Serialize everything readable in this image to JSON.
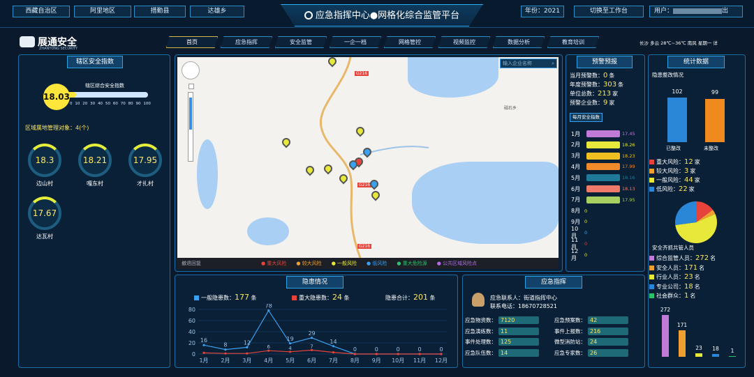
{
  "top_left_buttons": [
    "西藏自治区",
    "阿里地区",
    "措勤县",
    "达雄乡"
  ],
  "title": "应急指挥中心●网格化综合监管平台",
  "year_label": "年份：2021",
  "switch_label": "切换至工作台",
  "user_label": "用户：",
  "logout_label": "出",
  "logo": {
    "main": "展通安全",
    "sub": "ZHANTONG SECURITY"
  },
  "nav": [
    "首页",
    "应急指挥",
    "安全监管",
    "一企一档",
    "网格管控",
    "视频监控",
    "数据分析",
    "教育培训"
  ],
  "weather": "长沙  多云 28℃~36℃  南风  星期一  详",
  "left": {
    "title": "辖区安全指数",
    "index_value": "18.03",
    "index_label": "辖区综合安全指数",
    "scale": [
      "0",
      "10",
      "20",
      "30",
      "40",
      "50",
      "60",
      "70",
      "80",
      "90",
      "100"
    ],
    "area_label": "区域属地管理对象：4(个)",
    "villages": [
      {
        "name": "边山村",
        "value": "18.3"
      },
      {
        "name": "嘎东村",
        "value": "18.21"
      },
      {
        "name": "才扎村",
        "value": "17.95"
      },
      {
        "name": "达瓦村",
        "value": "17.67"
      }
    ]
  },
  "map": {
    "search_placeholder": "输入企业名称",
    "road": "G216",
    "place": "磁石乡",
    "legend": [
      "重大风险",
      "较大风险",
      "一般风险",
      "低风险",
      "重大危险源",
      "公共区域风险点"
    ],
    "legend_colors": [
      "#e8433b",
      "#f0a030",
      "#e8e83a",
      "#3aa0f0",
      "#2ac26a",
      "#b56ae8"
    ],
    "bottom_label": "撤退回复"
  },
  "warn": {
    "title": "预警预报",
    "stats": [
      {
        "label": "当月预警数：",
        "value": "0",
        "unit": "条"
      },
      {
        "label": "年度预警数：",
        "value": "303",
        "unit": "条"
      },
      {
        "label": "单位总数：",
        "value": "213",
        "unit": "家"
      },
      {
        "label": "预警企业数：",
        "value": "9",
        "unit": "家"
      }
    ],
    "button": "每月安全指数",
    "months": [
      {
        "m": "1月",
        "v": "17.45",
        "color": "#c07ad8",
        "frac": 0.8
      },
      {
        "m": "2月",
        "v": "18.26",
        "color": "#e8e83a",
        "frac": 0.8
      },
      {
        "m": "3月",
        "v": "18.23",
        "color": "#f0c020",
        "frac": 0.8
      },
      {
        "m": "4月",
        "v": "17.99",
        "color": "#f08a2a",
        "frac": 0.8
      },
      {
        "m": "5月",
        "v": "18.16",
        "color": "#1f7a9a",
        "frac": 0.8
      },
      {
        "m": "6月",
        "v": "18.13",
        "color": "#f07a6a",
        "frac": 0.8
      },
      {
        "m": "7月",
        "v": "17.95",
        "color": "#a8d060",
        "frac": 0.8
      },
      {
        "m": "8月",
        "v": "0",
        "color": "#e8e83a",
        "frac": 0
      },
      {
        "m": "9月",
        "v": "0",
        "color": "#e8e83a",
        "frac": 0
      },
      {
        "m": "10月",
        "v": "0",
        "color": "#3aa0f0",
        "frac": 0
      },
      {
        "m": "11月",
        "v": "0",
        "color": "#e8433b",
        "frac": 0
      },
      {
        "m": "12月",
        "v": "0",
        "color": "#e8e83a",
        "frac": 0
      }
    ]
  },
  "stats": {
    "title": "统计数据",
    "rect_title": "隐患整改情况",
    "done_label": "已整改",
    "done_value": "102",
    "undone_label": "未整改",
    "undone_value": "99",
    "risks": [
      {
        "label": "重大风险：",
        "value": "12",
        "unit": "家",
        "color": "#e8433b"
      },
      {
        "label": "较大风险：",
        "value": "3",
        "unit": "家",
        "color": "#f0a030"
      },
      {
        "label": "一般风险：",
        "value": "44",
        "unit": "家",
        "color": "#e8e83a"
      },
      {
        "label": "低风险：",
        "value": "22",
        "unit": "家",
        "color": "#2a86d6"
      }
    ],
    "staff_title": "安全齐抓共管人员",
    "staff": [
      {
        "label": "综合监管人员：",
        "value": "272",
        "unit": "名",
        "color": "#c07ad8"
      },
      {
        "label": "安全人员：",
        "value": "171",
        "unit": "名",
        "color": "#f0a030"
      },
      {
        "label": "行业人员：",
        "value": "23",
        "unit": "名",
        "color": "#e8e83a"
      },
      {
        "label": "专业公司：",
        "value": "18",
        "unit": "名",
        "color": "#2a86d6"
      },
      {
        "label": "社会群众：",
        "value": "1",
        "unit": "名",
        "color": "#2ac26a"
      }
    ],
    "staff_bars": [
      "272",
      "171",
      "23",
      "18",
      "1"
    ]
  },
  "hazard": {
    "title": "隐患情况",
    "general_label": "一般隐患数：",
    "general_value": "177",
    "general_unit": "条",
    "major_label": "重大隐患数：",
    "major_value": "24",
    "major_unit": "条",
    "total_label": "隐患合计：",
    "total_value": "201",
    "total_unit": "条"
  },
  "chart_data": {
    "type": "line",
    "x": [
      "1月",
      "2月",
      "3月",
      "4月",
      "5月",
      "6月",
      "7月",
      "8月",
      "9月",
      "10月",
      "11月",
      "12月"
    ],
    "ylim": [
      0,
      80
    ],
    "yticks": [
      "0",
      "20",
      "40",
      "60",
      "80"
    ],
    "series": [
      {
        "name": "一般隐患数",
        "color": "#3aa0f0",
        "values": [
          16,
          8,
          12,
          78,
          19,
          29,
          14,
          0,
          0,
          0,
          0,
          0
        ]
      },
      {
        "name": "重大隐患数",
        "color": "#e8433b",
        "values": [
          2,
          1,
          1,
          6,
          4,
          7,
          3,
          0,
          0,
          0,
          0,
          0
        ]
      }
    ],
    "labels": [
      "16",
      "8",
      "12",
      "78",
      "19",
      "29",
      "14",
      "0",
      "0",
      "0",
      "0",
      "0"
    ],
    "labels2": [
      "2",
      "1",
      "1",
      "6",
      "4",
      "7",
      "3"
    ]
  },
  "emergency": {
    "title": "应急指挥",
    "contact_label": "应急联系人：",
    "contact_value": "街道指挥中心",
    "phone_label": "联系电话：",
    "phone_value": "18670728521",
    "left_items": [
      {
        "label": "应急物资数：",
        "value": "7120"
      },
      {
        "label": "应急演练数：",
        "value": "11"
      },
      {
        "label": "事件处理数：",
        "value": "125"
      },
      {
        "label": "应急队伍数：",
        "value": "14"
      }
    ],
    "right_items": [
      {
        "label": "应急预案数：",
        "value": "42"
      },
      {
        "label": "事件上报数：",
        "value": "216"
      },
      {
        "label": "微型消防站：",
        "value": "24"
      },
      {
        "label": "应急专家数：",
        "value": "26"
      }
    ]
  }
}
